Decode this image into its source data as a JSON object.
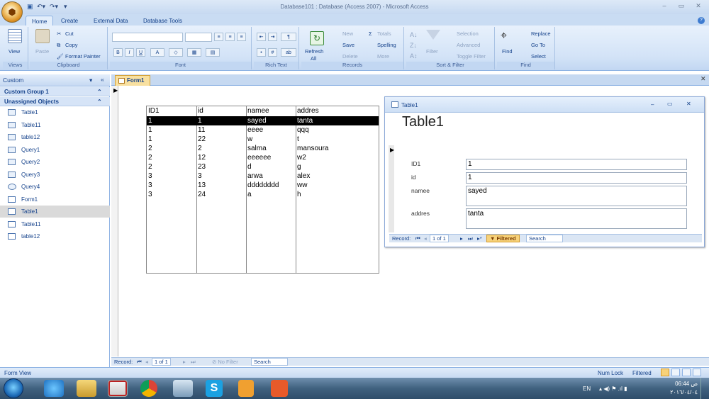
{
  "window": {
    "title": "Database101 : Database (Access 2007) - Microsoft Access"
  },
  "ribbon_tabs": [
    "Home",
    "Create",
    "External Data",
    "Database Tools"
  ],
  "ribbon": {
    "views": {
      "view_label": "View",
      "group": "Views"
    },
    "clipboard": {
      "paste": "Paste",
      "cut": "Cut",
      "copy": "Copy",
      "format_painter": "Format Painter",
      "group": "Clipboard"
    },
    "font": {
      "group": "Font"
    },
    "rich_text": {
      "group": "Rich Text"
    },
    "records": {
      "refresh": "Refresh",
      "refresh_sub": "All",
      "new": "New",
      "save": "Save",
      "delete": "Delete",
      "totals": "Totals",
      "spelling": "Spelling",
      "more": "More",
      "group": "Records"
    },
    "sort_filter": {
      "filter": "Filter",
      "selection": "Selection",
      "advanced": "Advanced",
      "toggle_filter": "Toggle Filter",
      "group": "Sort & Filter"
    },
    "find": {
      "find": "Find",
      "replace": "Replace",
      "goto": "Go To",
      "select": "Select",
      "group": "Find"
    }
  },
  "nav": {
    "header": "Custom",
    "group1": "Custom Group 1",
    "group2": "Unassigned Objects",
    "items": [
      {
        "label": "Table1",
        "icon": "table-icon"
      },
      {
        "label": "Table11",
        "icon": "table-icon"
      },
      {
        "label": "table12",
        "icon": "table-icon"
      },
      {
        "label": "Query1",
        "icon": "query-icon"
      },
      {
        "label": "Query2",
        "icon": "query-icon"
      },
      {
        "label": "Query3",
        "icon": "query-icon"
      },
      {
        "label": "Query4",
        "icon": "union-query-icon"
      },
      {
        "label": "Form1",
        "icon": "form-icon"
      },
      {
        "label": "Table1",
        "icon": "form-icon"
      },
      {
        "label": "Table11",
        "icon": "form-icon"
      },
      {
        "label": "table12",
        "icon": "form-icon"
      }
    ]
  },
  "form_tab": "Form1",
  "grid": {
    "headers": [
      "ID1",
      "id",
      "namee",
      "addres"
    ],
    "rows": [
      [
        "1",
        "1",
        "sayed",
        "tanta"
      ],
      [
        "1",
        "11",
        "eeee",
        "qqq"
      ],
      [
        "1",
        "22",
        "w",
        "t"
      ],
      [
        "2",
        "2",
        "salma",
        "mansoura"
      ],
      [
        "2",
        "12",
        "eeeeee",
        "w2"
      ],
      [
        "2",
        "23",
        "d",
        "g"
      ],
      [
        "3",
        "3",
        "arwa",
        "alex"
      ],
      [
        "3",
        "13",
        "dddddddd",
        "ww"
      ],
      [
        "3",
        "24",
        "a",
        "h"
      ]
    ]
  },
  "popup": {
    "title": "Table1",
    "heading": "Table1",
    "fields": [
      {
        "label": "ID1",
        "value": "1"
      },
      {
        "label": "id",
        "value": "1"
      },
      {
        "label": "namee",
        "value": "sayed"
      },
      {
        "label": "addres",
        "value": "tanta"
      }
    ],
    "record_label": "Record:",
    "record_pos": "1 of 1",
    "filter_status": "Filtered",
    "search": "Search"
  },
  "main_record": {
    "label": "Record:",
    "pos": "1 of 1",
    "filter": "No Filter",
    "search": "Search"
  },
  "status": {
    "left": "Form View",
    "numlock": "Num Lock",
    "filtered": "Filtered"
  },
  "taskbar": {
    "lang": "EN",
    "time": "06:44 ص",
    "date": "٢٠١٦/٠٤/٠٤"
  },
  "colors": {
    "accent": "#15428b",
    "ribbon": "#d3e3f7",
    "taskbar": "#40617f"
  }
}
